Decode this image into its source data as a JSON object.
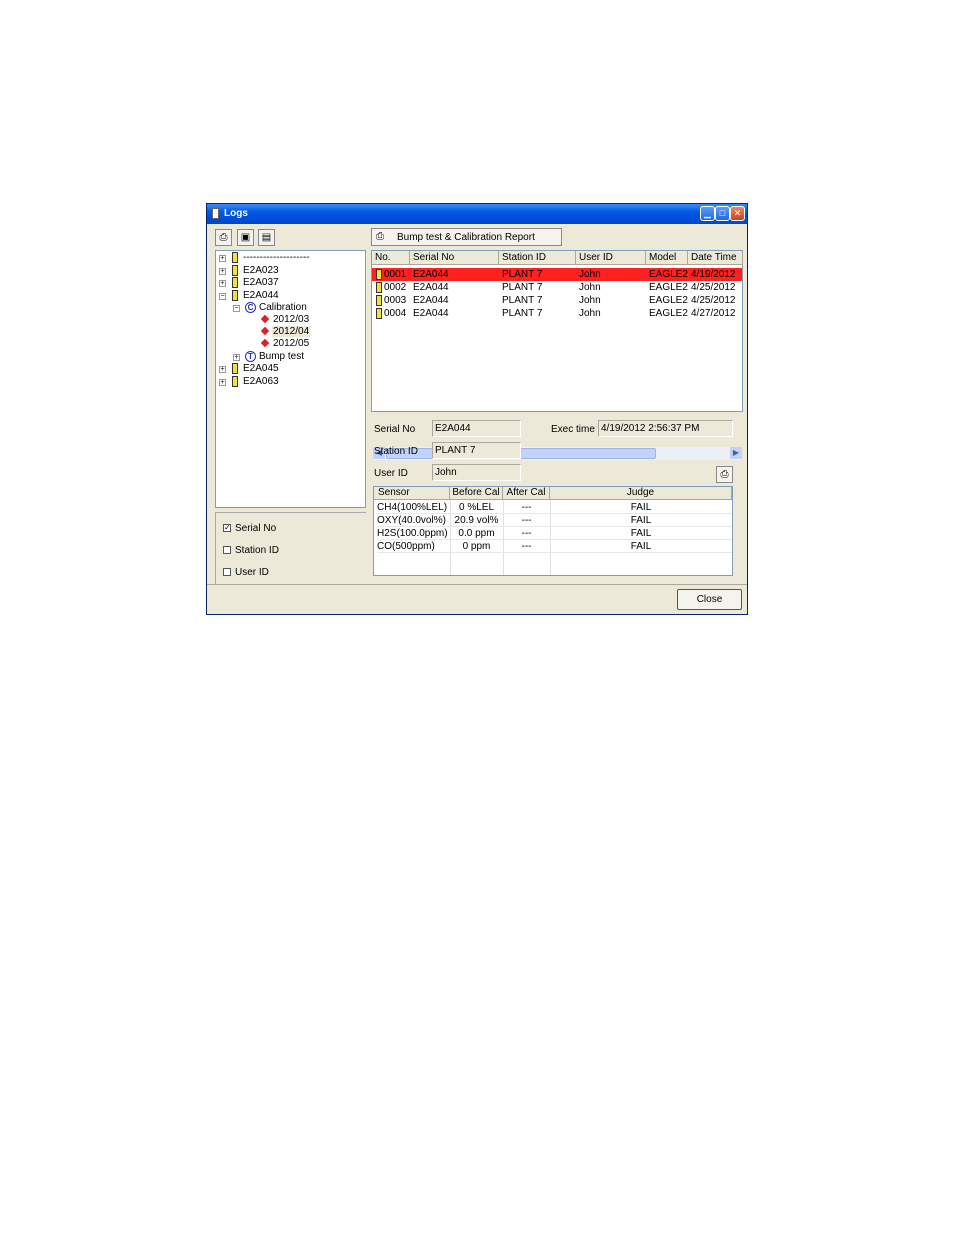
{
  "window": {
    "title": "Logs"
  },
  "toolbar": {
    "print_icon": "printer-icon",
    "save_icon": "floppy-icon",
    "clipboard_icon": "clipboard-icon"
  },
  "report_button": {
    "label": "Bump test & Calibration Report",
    "icon": "printer-icon"
  },
  "tree": {
    "items": [
      {
        "label": "--------------------"
      },
      {
        "label": "E2A023"
      },
      {
        "label": "E2A037"
      },
      {
        "label": "E2A044"
      },
      {
        "label": "Calibration"
      },
      {
        "label": "2012/03"
      },
      {
        "label": "2012/04"
      },
      {
        "label": "2012/05"
      },
      {
        "label": "Bump test"
      },
      {
        "label": "E2A045"
      },
      {
        "label": "E2A063"
      }
    ]
  },
  "filters": [
    {
      "label": "Serial No",
      "checked": true
    },
    {
      "label": "Station ID",
      "checked": false
    },
    {
      "label": "User ID",
      "checked": false
    }
  ],
  "list": {
    "columns": [
      "No.",
      "Serial No",
      "Station ID",
      "User ID",
      "Model",
      "Date Time"
    ],
    "rows": [
      [
        "0001",
        "E2A044",
        "PLANT 7",
        "John",
        "EAGLE2",
        "4/19/2012"
      ],
      [
        "0002",
        "E2A044",
        "PLANT 7",
        "John",
        "EAGLE2",
        "4/25/2012"
      ],
      [
        "0003",
        "E2A044",
        "PLANT 7",
        "John",
        "EAGLE2",
        "4/25/2012"
      ],
      [
        "0004",
        "E2A044",
        "PLANT 7",
        "John",
        "EAGLE2",
        "4/27/2012"
      ]
    ],
    "selected_row": 0,
    "selected_color": "#ff2020"
  },
  "detail": {
    "serial_label": "Serial No",
    "serial_value": "E2A044",
    "station_label": "Station ID",
    "station_value": "PLANT 7",
    "user_label": "User ID",
    "user_value": "John",
    "exec_label": "Exec time",
    "exec_value": "4/19/2012 2:56:37 PM"
  },
  "sensor_table": {
    "columns": [
      "Sensor",
      "Before Cal",
      "After Cal",
      "Judge"
    ],
    "rows": [
      [
        "CH4(100%LEL)",
        "0 %LEL",
        "---",
        "FAIL"
      ],
      [
        "OXY(40.0vol%)",
        "20.9 vol%",
        "---",
        "FAIL"
      ],
      [
        "H2S(100.0ppm)",
        "0.0 ppm",
        "---",
        "FAIL"
      ],
      [
        "CO(500ppm)",
        "0 ppm",
        "---",
        "FAIL"
      ]
    ]
  },
  "close_button": {
    "label": "Close"
  }
}
